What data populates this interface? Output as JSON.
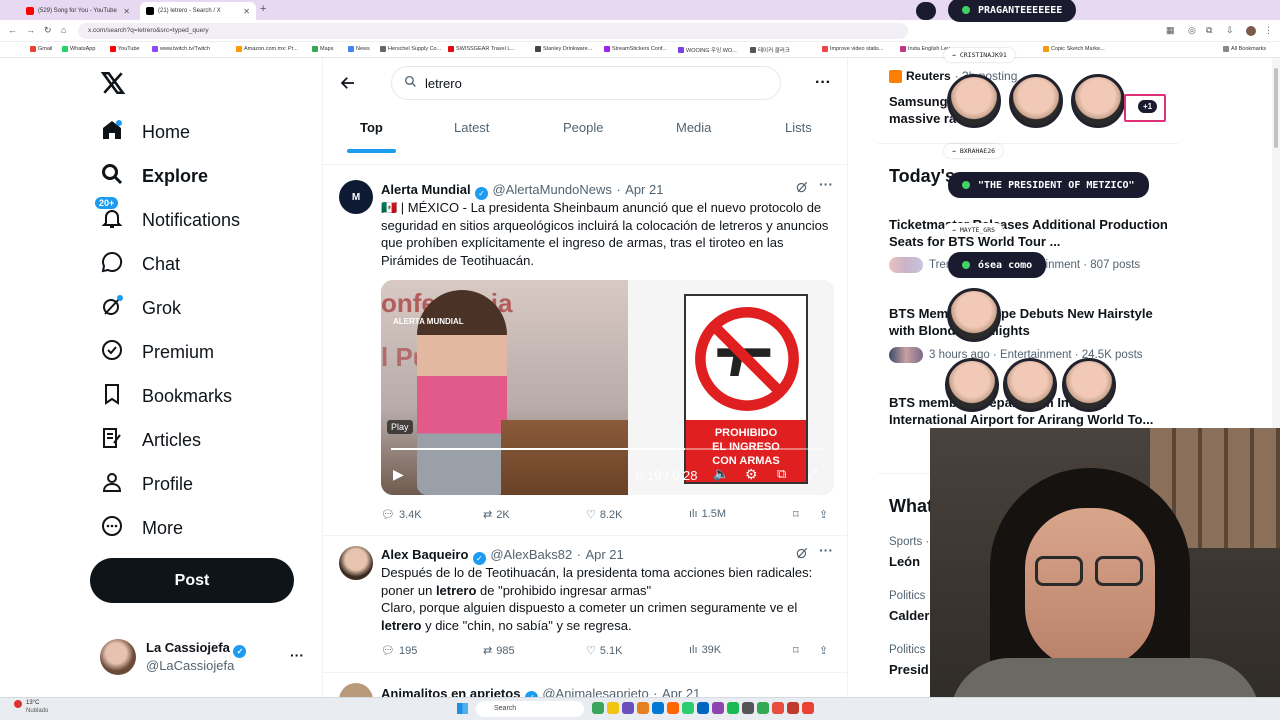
{
  "browser": {
    "tabs": [
      {
        "label": "(529) Song for You - YouTube",
        "favicon_color": "#ff0000"
      },
      {
        "label": "(21) letrero - Search / X",
        "favicon_color": "#000000"
      }
    ],
    "url": "x.com/search?q=letrero&src=typed_query",
    "bookmarks": [
      "Gmail",
      "WhatsApp",
      "YouTube",
      "www.twitch.tv/Twitch",
      "Amazon.com.mx: Pr...",
      "Maps",
      "News",
      "Herschel Supply Co...",
      "SWISSGEAR Travel L...",
      "Stanley Drinkware...",
      "StreamStickers Conf...",
      "WOOING 우잉 WO...",
      "테이커 클러크",
      "Improve video statis...",
      "Insta English Lev...",
      "Copic Sketch Marke...",
      "All Bookmarks"
    ]
  },
  "nav": {
    "items": [
      {
        "label": "Home",
        "icon": "home-icon"
      },
      {
        "label": "Explore",
        "icon": "search-icon"
      },
      {
        "label": "Notifications",
        "icon": "bell-icon",
        "badge": "20+"
      },
      {
        "label": "Chat",
        "icon": "chat-icon"
      },
      {
        "label": "Grok",
        "icon": "grok-icon"
      },
      {
        "label": "Premium",
        "icon": "premium-icon"
      },
      {
        "label": "Bookmarks",
        "icon": "bookmark-icon"
      },
      {
        "label": "Articles",
        "icon": "articles-icon"
      },
      {
        "label": "Profile",
        "icon": "profile-icon"
      },
      {
        "label": "More",
        "icon": "more-icon"
      }
    ],
    "post_label": "Post",
    "account": {
      "name": "La Cassiojefa",
      "handle": "@LaCassiojefa"
    }
  },
  "search": {
    "query": "letrero",
    "tabs": [
      "Top",
      "Latest",
      "People",
      "Media",
      "Lists"
    ],
    "active_tab": "Top"
  },
  "tweets": [
    {
      "name": "Alerta Mundial",
      "handle": "@AlertaMundoNews",
      "date": "Apr 21",
      "text": "🇲🇽 | MÉXICO - La presidenta Sheinbaum anunció que el nuevo protocolo de seguridad en sitios arqueológicos incluirá la colocación de letreros y anuncios que prohíben explícitamente el ingreso de armas, tras el tiroteo en las Pirámides de Teotihuacán.",
      "video": {
        "play_label": "Play",
        "time": "0:19 / 0:28",
        "progress": 0.68,
        "watermark": "ALERTA MUNDIAL",
        "backdrop": "onferencia",
        "backdrop2": "l Pueblo",
        "sign_line1": "PROHIBIDO",
        "sign_line2": "EL INGRESO",
        "sign_line3": "CON ARMAS"
      },
      "replies": "3.4K",
      "reposts": "2K",
      "likes": "8.2K",
      "views": "1.5M"
    },
    {
      "name": "Alex Baqueiro",
      "handle": "@AlexBaks82",
      "date": "Apr 21",
      "text_parts": [
        "Después de lo de Teotihuacán, la presidenta toma acciones bien radicales: poner un ",
        "letrero",
        " de \"prohibido ingresar armas\"",
        "Claro, porque alguien dispuesto a cometer un crimen seguramente ve el ",
        "letrero",
        " y dice \"chin, no sabía\"  y se regresa."
      ],
      "replies": "195",
      "reposts": "985",
      "likes": "5.1K",
      "views": "39K"
    },
    {
      "name": "Animalitos en aprietos",
      "handle": "@Animalesaprieto",
      "date": "Apr 21"
    }
  ],
  "right": {
    "news_source": "Reuters",
    "news_meta": "· 3h posting",
    "headline1": "Samsung",
    "headline1b": "massive ra",
    "section_title": "Today's",
    "trends": [
      {
        "title": "Ticketmaster Releases Additional Production Seats for BTS World Tour ...",
        "meta": "Trending now · Entertainment · 807 posts"
      },
      {
        "title": "BTS Member J-Hope Debuts New Hairstyle with Blonde Highlights",
        "meta": "3 hours ago · Entertainment · 24.5K posts"
      },
      {
        "title": "BTS members Depart from Incheon International Airport for Arirang World To...",
        "meta": ""
      }
    ],
    "whats_title": "What",
    "whats": [
      {
        "cat": "Sports ·",
        "title": "León"
      },
      {
        "cat": "Politics",
        "title": "Calder"
      },
      {
        "cat": "Politics",
        "title": "Presid"
      }
    ]
  },
  "overlay": {
    "top_user": "PRAGANTEEEEEEE",
    "chat_users": [
      "CRISTINAJK91",
      "BXRAHAE26",
      "MAYTE_GRS"
    ],
    "msg1": "\"THE PRESIDENT OF METZICO\"",
    "msg2": "ósea como",
    "plus": "+1"
  },
  "taskbar": {
    "weather": "13°C",
    "weather_sub": "Nublado",
    "search_label": "Search"
  }
}
